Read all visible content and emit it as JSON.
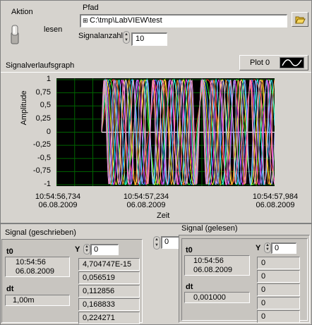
{
  "controls": {
    "action_label": "Aktion",
    "toggle_state_label": "lesen",
    "path_label": "Pfad",
    "path_value": "C:\\tmp\\LabVIEW\\test",
    "signal_count_label": "Signalanzahl",
    "signal_count_value": "10"
  },
  "graph": {
    "title": "Signalverlaufsgraph",
    "legend_plot": "Plot 0",
    "ylabel": "Amplitude",
    "xlabel": "Zeit"
  },
  "chart_data": {
    "type": "line",
    "ylabel": "Amplitude",
    "xlabel": "Zeit",
    "ylim": [
      -1,
      1
    ],
    "yticks": [
      "1",
      "0,75",
      "0,5",
      "0,25",
      "0",
      "-0,25",
      "-0,5",
      "-0,75",
      "-1"
    ],
    "xticks": [
      {
        "time": "10:54:56,734",
        "date": "06.08.2009"
      },
      {
        "time": "10:54:57,234",
        "date": "06.08.2009"
      },
      {
        "time": "10:54:57,984",
        "date": "06.08.2009"
      }
    ],
    "legend": [
      "Plot 0"
    ],
    "series_colors": [
      "#ffffff",
      "#ff3333",
      "#33ff33",
      "#3399ff",
      "#ffff33",
      "#ff33ff",
      "#33ffff",
      "#ff9933",
      "#9999ff",
      "#ff99cc"
    ],
    "grid": true
  },
  "written": {
    "label": "Signal (geschrieben)",
    "t0_label": "t0",
    "t0_time": "10:54:56",
    "t0_date": "06.08.2009",
    "dt_label": "dt",
    "dt_value": "1,00m",
    "y_label": "Y",
    "y_index": "0",
    "y_values": [
      "4,704747E-15",
      "0,056519",
      "0,112856",
      "0,168833",
      "0,224271"
    ]
  },
  "array_index": "0",
  "read": {
    "label": "Signal (gelesen)",
    "t0_label": "t0",
    "t0_time": "10:54:56",
    "t0_date": "06.08.2009",
    "dt_label": "dt",
    "dt_value": "0,001000",
    "y_label": "Y",
    "y_index": "0",
    "y_values": [
      "0",
      "0",
      "0",
      "0",
      "0"
    ]
  },
  "colors": {
    "panel": "#d6d3ce",
    "plot_bg": "#000000",
    "grid": "#006400"
  }
}
